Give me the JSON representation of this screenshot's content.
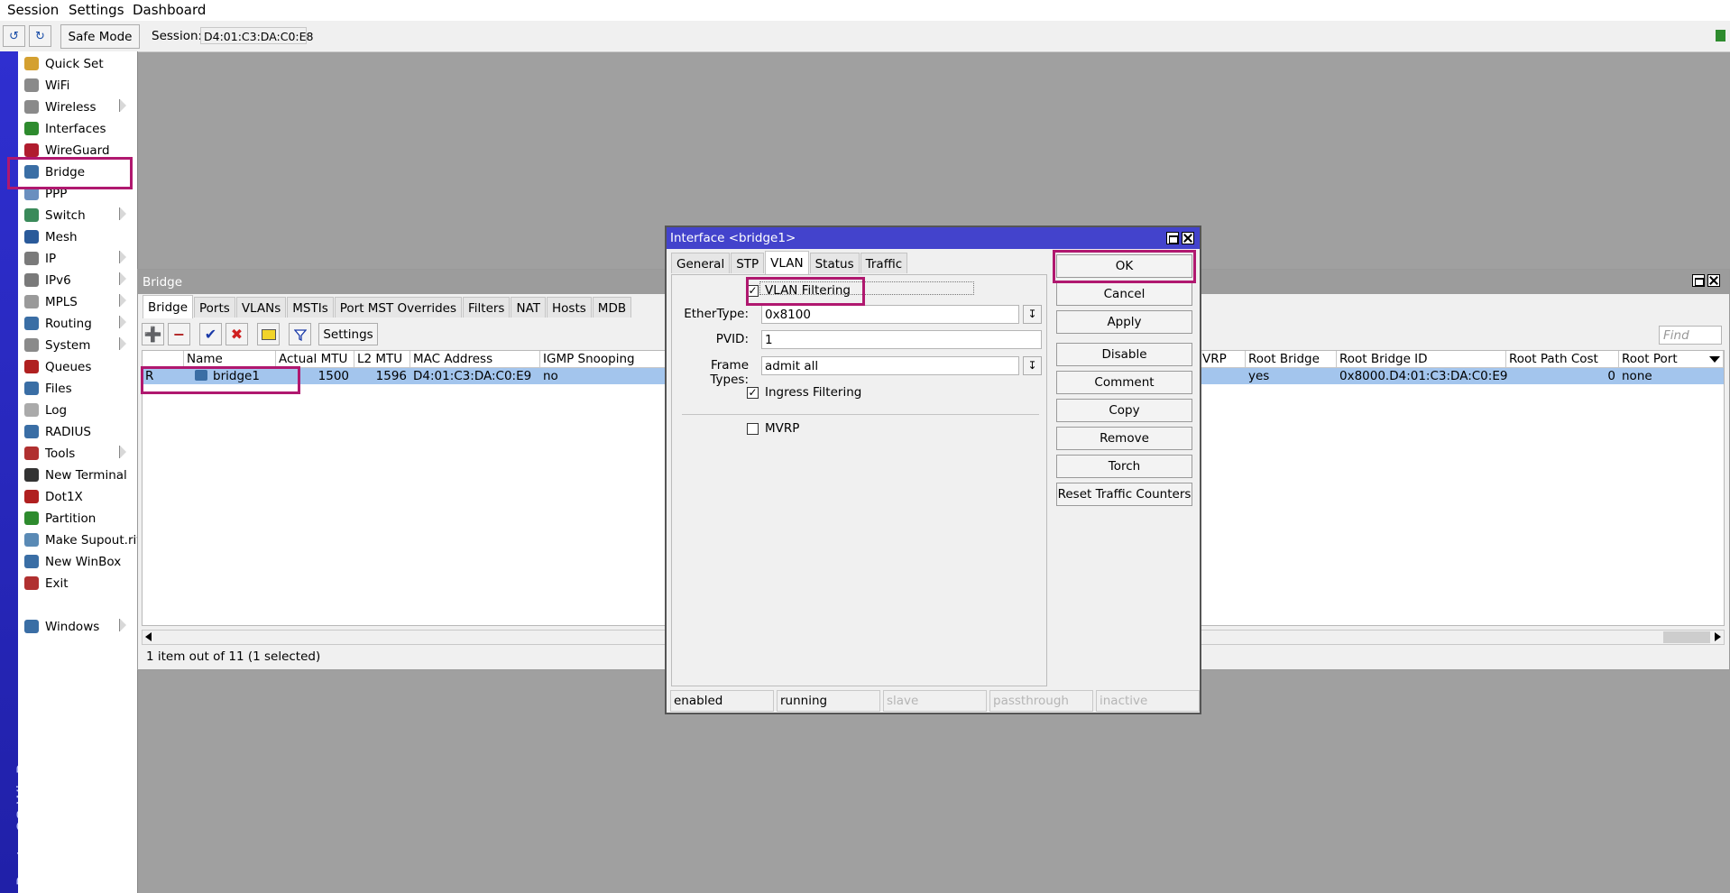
{
  "menubar": {
    "items": [
      "Session",
      "Settings",
      "Dashboard"
    ]
  },
  "toolbar": {
    "undo_icon": "undo-icon",
    "redo_icon": "redo-icon",
    "safe_mode": "Safe Mode",
    "session_label": "Session:",
    "session_value": "D4:01:C3:DA:C0:E8"
  },
  "sidebar": {
    "brand": "RouterOS WinBox",
    "items": [
      {
        "label": "Quick Set",
        "icon": "wand-icon",
        "color": "#d4a030",
        "submenu": false
      },
      {
        "label": "WiFi",
        "icon": "wifi-icon",
        "color": "#8a8a8a",
        "submenu": false
      },
      {
        "label": "Wireless",
        "icon": "wireless-icon",
        "color": "#8a8a8a",
        "submenu": true
      },
      {
        "label": "Interfaces",
        "icon": "interfaces-icon",
        "color": "#2e8b2e",
        "submenu": false
      },
      {
        "label": "WireGuard",
        "icon": "wireguard-icon",
        "color": "#b01c2e",
        "submenu": false
      },
      {
        "label": "Bridge",
        "icon": "bridge-icon",
        "color": "#3a6ea5",
        "submenu": false
      },
      {
        "label": "PPP",
        "icon": "ppp-icon",
        "color": "#6a8fbf",
        "submenu": false
      },
      {
        "label": "Switch",
        "icon": "switch-icon",
        "color": "#3a8a5a",
        "submenu": true
      },
      {
        "label": "Mesh",
        "icon": "mesh-icon",
        "color": "#2a5a9a",
        "submenu": false
      },
      {
        "label": "IP",
        "icon": "ip-icon",
        "color": "#7a7a7a",
        "submenu": true
      },
      {
        "label": "IPv6",
        "icon": "ipv6-icon",
        "color": "#7a7a7a",
        "submenu": true
      },
      {
        "label": "MPLS",
        "icon": "mpls-icon",
        "color": "#9a9a9a",
        "submenu": true
      },
      {
        "label": "Routing",
        "icon": "routing-icon",
        "color": "#3a6ea5",
        "submenu": true
      },
      {
        "label": "System",
        "icon": "system-icon",
        "color": "#8a8a8a",
        "submenu": true
      },
      {
        "label": "Queues",
        "icon": "queues-icon",
        "color": "#b02020",
        "submenu": false
      },
      {
        "label": "Files",
        "icon": "files-icon",
        "color": "#3a6ea5",
        "submenu": false
      },
      {
        "label": "Log",
        "icon": "log-icon",
        "color": "#aaaaaa",
        "submenu": false
      },
      {
        "label": "RADIUS",
        "icon": "radius-icon",
        "color": "#3a6ea5",
        "submenu": false
      },
      {
        "label": "Tools",
        "icon": "tools-icon",
        "color": "#b03030",
        "submenu": true
      },
      {
        "label": "New Terminal",
        "icon": "terminal-icon",
        "color": "#333333",
        "submenu": false
      },
      {
        "label": "Dot1X",
        "icon": "dot1x-icon",
        "color": "#b02020",
        "submenu": false
      },
      {
        "label": "Partition",
        "icon": "partition-icon",
        "color": "#2e8b2e",
        "submenu": false
      },
      {
        "label": "Make Supout.rif",
        "icon": "supout-icon",
        "color": "#5a8ab5",
        "submenu": false
      },
      {
        "label": "New WinBox",
        "icon": "winbox-icon",
        "color": "#3a6ea5",
        "submenu": false
      },
      {
        "label": "Exit",
        "icon": "exit-icon",
        "color": "#b03030",
        "submenu": false
      },
      {
        "label": "Windows",
        "icon": "windows-icon",
        "color": "#3a6ea5",
        "submenu": true
      }
    ]
  },
  "bridge_window": {
    "title": "Bridge",
    "tabs": [
      "Bridge",
      "Ports",
      "VLANs",
      "MSTIs",
      "Port MST Overrides",
      "Filters",
      "NAT",
      "Hosts",
      "MDB"
    ],
    "settings_label": "Settings",
    "find_placeholder": "Find",
    "columns": [
      "Name",
      "Actual MTU",
      "L2 MTU",
      "MAC Address",
      "IGMP Snooping",
      "VRP",
      "Root Bridge",
      "Root Bridge ID",
      "Root Path Cost",
      "Root Port"
    ],
    "row": {
      "flag": "R",
      "name": "bridge1",
      "actual_mtu": "1500",
      "l2_mtu": "1596",
      "mac": "D4:01:C3:DA:C0:E9",
      "igmp": "no",
      "root_bridge": "yes",
      "root_bridge_id": "0x8000.D4:01:C3:DA:C0:E9",
      "root_path_cost": "0",
      "root_port": "none"
    },
    "status": "1 item out of 11 (1 selected)"
  },
  "dialog": {
    "title": "Interface <bridge1>",
    "tabs": [
      "General",
      "STP",
      "VLAN",
      "Status",
      "Traffic"
    ],
    "active_tab": "VLAN",
    "vlan_filtering": {
      "label": "VLAN Filtering",
      "checked": true
    },
    "ethertype": {
      "label": "EtherType:",
      "value": "0x8100"
    },
    "pvid": {
      "label": "PVID:",
      "value": "1"
    },
    "frame_types": {
      "label": "Frame Types:",
      "value": "admit all"
    },
    "ingress_filtering": {
      "label": "Ingress Filtering",
      "checked": true
    },
    "mvrp": {
      "label": "MVRP",
      "checked": false
    },
    "buttons": [
      "OK",
      "Cancel",
      "Apply",
      "Disable",
      "Comment",
      "Copy",
      "Remove",
      "Torch",
      "Reset Traffic Counters"
    ],
    "status": [
      "enabled",
      "running",
      "slave",
      "passthrough",
      "inactive"
    ]
  },
  "colors": {
    "highlight": "#b0186f",
    "selected_row": "#a3c5ed",
    "dialog_title": "#4343cc",
    "vertical_bar": "#2a2ac0"
  }
}
